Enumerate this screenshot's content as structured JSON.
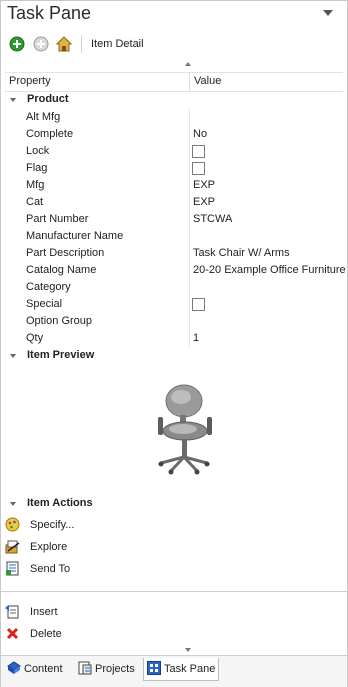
{
  "pane": {
    "title": "Task Pane",
    "toolbar": {
      "label": "Item Detail"
    }
  },
  "grid": {
    "columns": [
      "Property",
      "Value"
    ],
    "sections": {
      "product": "Product",
      "preview": "Item Preview",
      "actions": "Item Actions"
    },
    "rows": [
      {
        "key": "Alt Mfg",
        "value": ""
      },
      {
        "key": "Complete",
        "value": "No"
      },
      {
        "key": "Lock",
        "value": "",
        "checkbox": true
      },
      {
        "key": "Flag",
        "value": "",
        "checkbox": true
      },
      {
        "key": "Mfg",
        "value": "EXP"
      },
      {
        "key": "Cat",
        "value": "EXP"
      },
      {
        "key": "Part Number",
        "value": "STCWA"
      },
      {
        "key": "Manufacturer Name",
        "value": ""
      },
      {
        "key": "Part Description",
        "value": "Task Chair W/ Arms"
      },
      {
        "key": "Catalog Name",
        "value": "20-20 Example Office Furniture"
      },
      {
        "key": "Category",
        "value": ""
      },
      {
        "key": "Special",
        "value": "",
        "checkbox": true
      },
      {
        "key": "Option Group",
        "value": ""
      },
      {
        "key": "Qty",
        "value": "1"
      }
    ]
  },
  "actions": [
    {
      "label": "Specify...",
      "icon": "specify-icon"
    },
    {
      "label": "Explore",
      "icon": "explore-icon"
    },
    {
      "label": "Send To",
      "icon": "send-to-icon"
    }
  ],
  "bottom_actions": [
    {
      "label": "Insert",
      "icon": "insert-icon"
    },
    {
      "label": "Delete",
      "icon": "delete-icon"
    }
  ],
  "tabs": [
    {
      "label": "Content",
      "icon": "content-icon"
    },
    {
      "label": "Projects",
      "icon": "projects-icon"
    },
    {
      "label": "Task Pane",
      "icon": "task-pane-icon",
      "active": true
    }
  ],
  "colors": {
    "accent_blue": "#2a64c8",
    "delete_red": "#d4261f",
    "add_green": "#2f9a2f"
  }
}
